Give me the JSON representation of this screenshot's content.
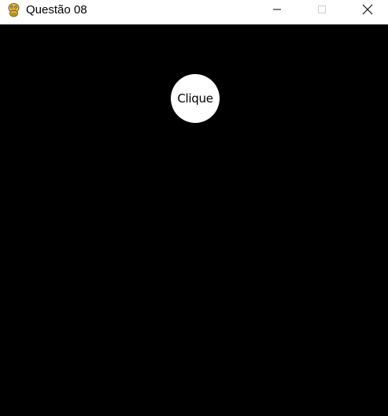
{
  "window": {
    "title": "Questão 08",
    "icon": "pygame-snake-icon",
    "controls": {
      "minimize_icon": "minimize-icon",
      "maximize_icon": "maximize-icon",
      "close_icon": "close-icon"
    }
  },
  "canvas": {
    "background": "#000000",
    "button": {
      "label": "Clique",
      "fill": "#ffffff",
      "text_color": "#000000"
    }
  }
}
